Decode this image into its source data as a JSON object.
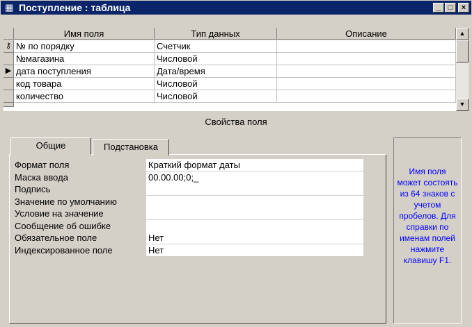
{
  "window": {
    "title": "Поступление : таблица",
    "minimize": "_",
    "maximize": "□",
    "close": "×"
  },
  "grid": {
    "columns": [
      "Имя поля",
      "Тип данных",
      "Описание"
    ],
    "rows": [
      {
        "name": "№ по порядку",
        "type": "Счетчик",
        "description": "",
        "selector": "key"
      },
      {
        "name": "№магазина",
        "type": "Числовой",
        "description": "",
        "selector": ""
      },
      {
        "name": "дата поступления",
        "type": "Дата/время",
        "description": "",
        "selector": "current"
      },
      {
        "name": "код товара",
        "type": "Числовой",
        "description": "",
        "selector": ""
      },
      {
        "name": "количество",
        "type": "Числовой",
        "description": "",
        "selector": ""
      }
    ]
  },
  "properties": {
    "section_title": "Свойства поля",
    "tabs": [
      "Общие",
      "Подстановка"
    ],
    "active_tab": "Общие",
    "fields": [
      {
        "label": "Формат поля",
        "value": "Краткий формат даты"
      },
      {
        "label": "Маска ввода",
        "value": "00.00.00;0;_"
      },
      {
        "label": "Подпись",
        "value": ""
      },
      {
        "label": "Значение по умолчанию",
        "value": ""
      },
      {
        "label": "Условие на значение",
        "value": ""
      },
      {
        "label": "Сообщение об ошибке",
        "value": ""
      },
      {
        "label": "Обязательное поле",
        "value": "Нет"
      },
      {
        "label": "Индексированное поле",
        "value": "Нет"
      }
    ],
    "help_text": "Имя поля может состоять из 64 знаков с учетом пробелов. Для справки по именам полей нажмите клавишу F1."
  },
  "colors": {
    "titlebar": "#0a246a",
    "help_text": "#0000ff",
    "face": "#d4d0c8"
  }
}
